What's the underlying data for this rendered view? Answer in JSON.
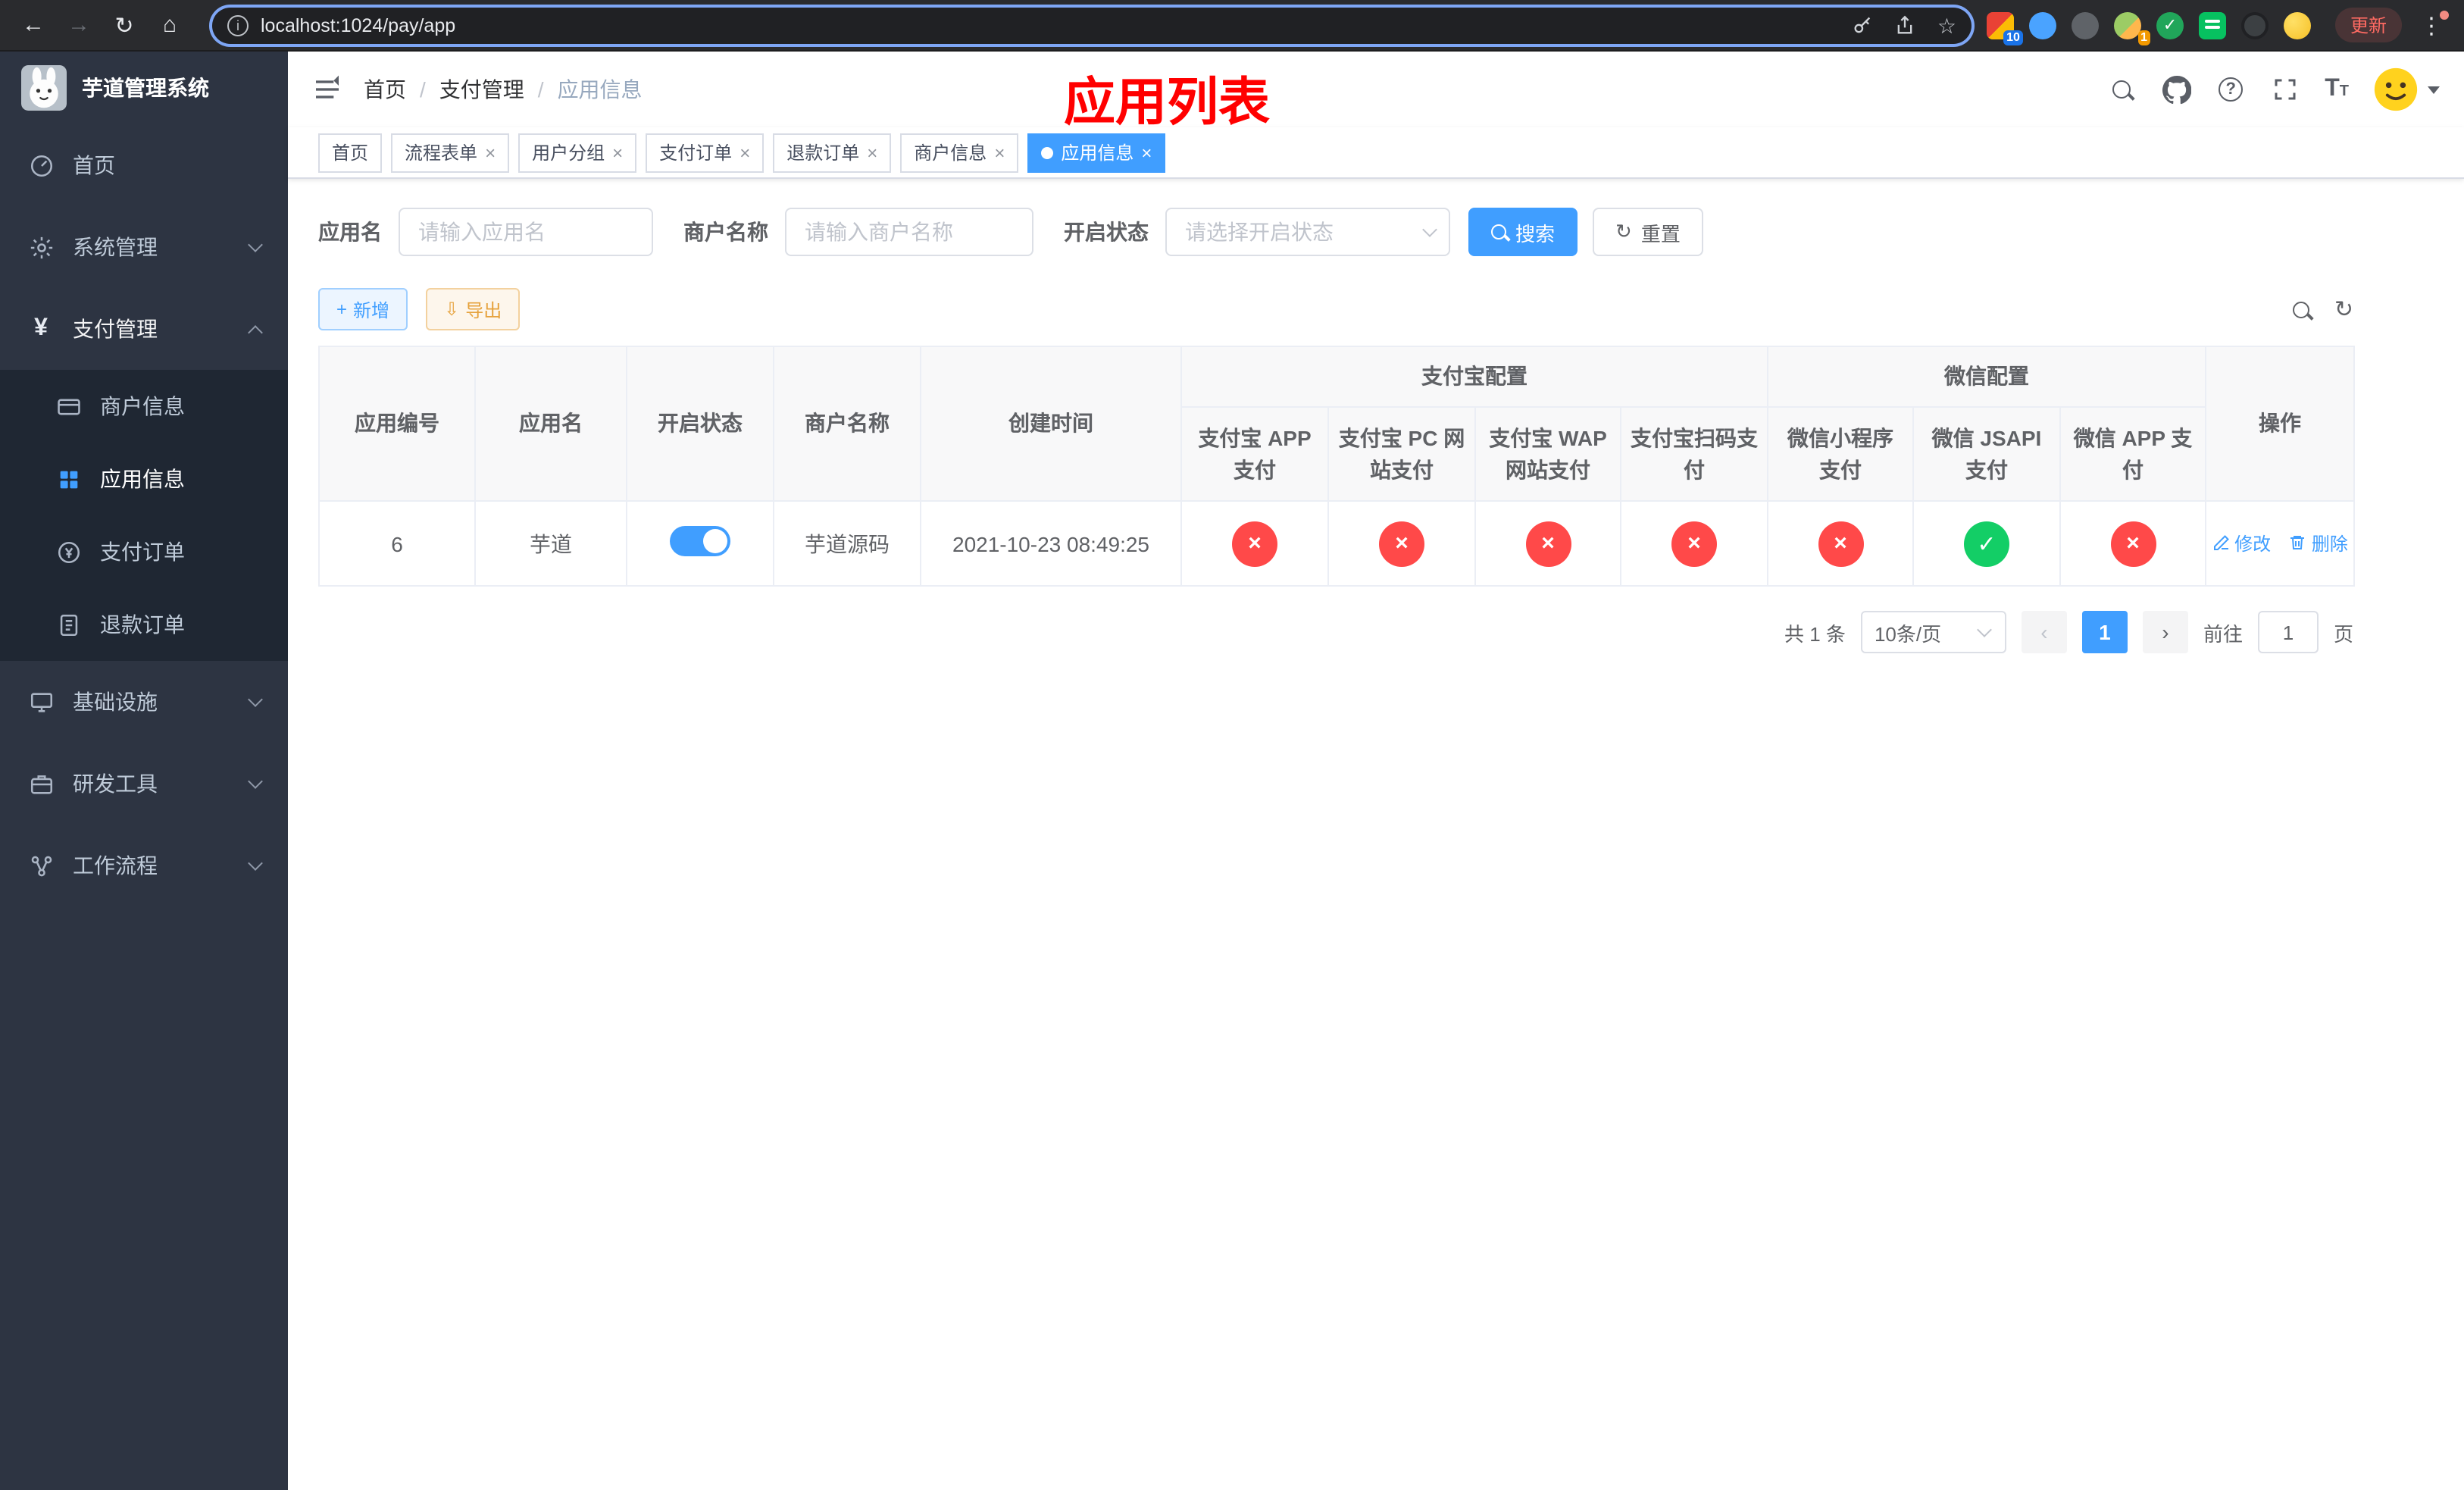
{
  "colors": {
    "accent": "#409eff",
    "danger": "#ff4949",
    "success": "#13ce66",
    "warning": "#e6a23c",
    "sidebar_bg": "#2d3442",
    "submenu_bg": "#1f2733",
    "overlay_red": "#ff0000"
  },
  "icons": {
    "back": "←",
    "forward": "→",
    "reload": "↻",
    "home": "⌂",
    "star": "☆",
    "more": "⋮",
    "info": "i",
    "question": "?",
    "text_big": "T",
    "text_small": "T",
    "refresh": "↻",
    "download": "⇩",
    "plus": "+",
    "close": "×",
    "prev": "‹",
    "next": "›",
    "yen": "¥"
  },
  "browser": {
    "url": "localhost:1024/pay/app",
    "update_button": "更新",
    "extension_badge": "10",
    "avatar_badge": "1"
  },
  "sidebar": {
    "app_title": "芋道管理系统",
    "items": [
      {
        "label": "首页"
      },
      {
        "label": "系统管理"
      },
      {
        "label": "支付管理"
      },
      {
        "label": "商户信息"
      },
      {
        "label": "应用信息"
      },
      {
        "label": "支付订单"
      },
      {
        "label": "退款订单"
      },
      {
        "label": "基础设施"
      },
      {
        "label": "研发工具"
      },
      {
        "label": "工作流程"
      }
    ]
  },
  "breadcrumb": {
    "separator": "/",
    "items": [
      {
        "label": "首页"
      },
      {
        "label": "支付管理"
      },
      {
        "label": "应用信息"
      }
    ]
  },
  "overlay_title": "应用列表",
  "tabs": [
    {
      "label": "首页"
    },
    {
      "label": "流程表单"
    },
    {
      "label": "用户分组"
    },
    {
      "label": "支付订单"
    },
    {
      "label": "退款订单"
    },
    {
      "label": "商户信息"
    },
    {
      "label": "应用信息"
    }
  ],
  "filters": {
    "app_name_label": "应用名",
    "app_name_placeholder": "请输入应用名",
    "merchant_label": "商户名称",
    "merchant_placeholder": "请输入商户名称",
    "status_label": "开启状态",
    "status_placeholder": "请选择开启状态",
    "search_button": "搜索",
    "reset_button": "重置"
  },
  "toolbar": {
    "add_button": "新增",
    "export_button": "导出"
  },
  "table": {
    "group_alipay": "支付宝配置",
    "group_wechat": "微信配置",
    "status_glyphs": {
      "yes": "✓",
      "no": "×"
    },
    "columns": [
      "应用编号",
      "应用名",
      "开启状态",
      "商户名称",
      "创建时间",
      "支付宝 APP 支付",
      "支付宝 PC 网站支付",
      "支付宝 WAP 网站支付",
      "支付宝扫码支付",
      "微信小程序支付",
      "微信 JSAPI 支付",
      "微信 APP 支付",
      "操作"
    ],
    "rows": [
      {
        "id": "6",
        "name": "芋道",
        "enabled": true,
        "merchant": "芋道源码",
        "created_at": "2021-10-23 08:49:25",
        "statuses": [
          "no",
          "no",
          "no",
          "no",
          "no",
          "yes",
          "no"
        ],
        "edit_label": "修改",
        "delete_label": "删除"
      }
    ]
  },
  "pagination": {
    "total_text": "共 1 条",
    "page_size": "10条/页",
    "current_page": "1",
    "goto_label": "前往",
    "goto_value": "1",
    "goto_suffix": "页"
  }
}
